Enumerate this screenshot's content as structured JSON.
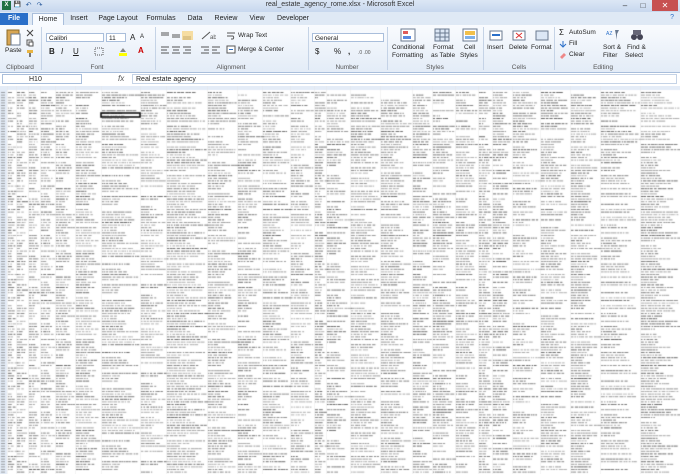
{
  "window": {
    "title": "real_estate_agency_rome.xlsx - Microsoft Excel",
    "minimize": "–",
    "maximize": "□",
    "close": "✕"
  },
  "qat": {
    "save": "💾",
    "undo": "↶",
    "redo": "↷"
  },
  "tabs": [
    "File",
    "Home",
    "Insert",
    "Page Layout",
    "Formulas",
    "Data",
    "Review",
    "View",
    "Developer"
  ],
  "ribbon": {
    "clipboard": {
      "paste": "Paste",
      "label": "Clipboard"
    },
    "font": {
      "name": "Calibri",
      "size": "11",
      "bold": "B",
      "italic": "I",
      "underline": "U",
      "grow": "A",
      "shrink": "A",
      "label": "Font"
    },
    "alignment": {
      "wrap": "Wrap Text",
      "merge": "Merge & Center",
      "label": "Alignment"
    },
    "number": {
      "format": "General",
      "currency": "$",
      "percent": "%",
      "comma": ",",
      "label": "Number"
    },
    "styles": {
      "conditional": "Conditional",
      "conditional2": "Formatting",
      "format_table": "Format",
      "format_table2": "as Table",
      "cell_styles": "Cell",
      "cell_styles2": "Styles",
      "label": "Styles"
    },
    "cells": {
      "insert": "Insert",
      "delete": "Delete",
      "format": "Format",
      "label": "Cells"
    },
    "editing": {
      "autosum": "AutoSum",
      "fill": "Fill",
      "clear": "Clear",
      "sort": "Sort &",
      "sort2": "Filter",
      "find": "Find &",
      "find2": "Select",
      "label": "Editing"
    }
  },
  "formula_bar": {
    "name_box": "H10",
    "fx": "fx",
    "content": "Real estate agency"
  },
  "colors": {
    "accent": "#2a6fc9",
    "grid": "#d4d4d4",
    "header_bg": "#e4ecf7"
  }
}
